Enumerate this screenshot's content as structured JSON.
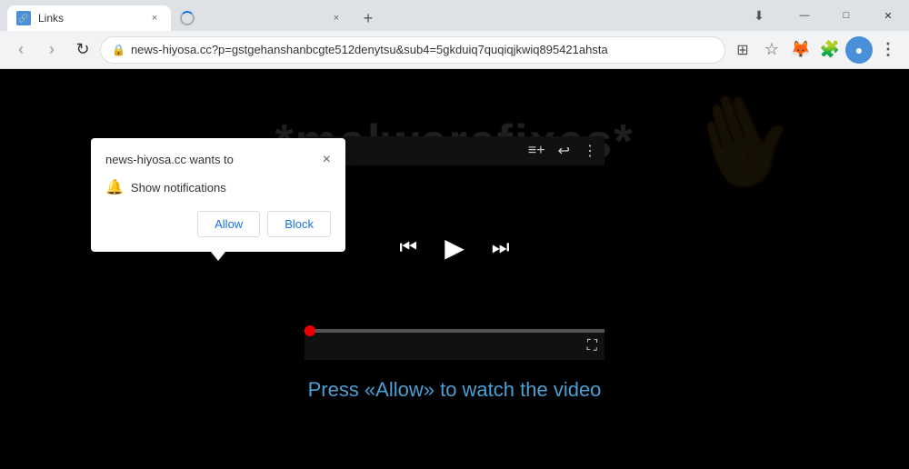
{
  "titlebar": {
    "tab1": {
      "favicon": "🔗",
      "title": "Links",
      "close_label": "×"
    },
    "tab2": {
      "close_label": "×"
    },
    "new_tab_label": "+",
    "window_controls": {
      "minimize": "—",
      "maximize": "□",
      "close": "✕"
    }
  },
  "toolbar": {
    "back_label": "‹",
    "forward_label": "›",
    "refresh_label": "↻",
    "url": "news-hiyosa.cc?p=gstgehanshanbcgte512denytsu&sub4=5gkduiq7quqiqjkwiq895421ahsta",
    "lock_icon": "🔒",
    "extensions_icon": "⬡",
    "star_icon": "☆",
    "fox_icon": "🦊",
    "puzzle_icon": "⬡",
    "profile_icon": "●",
    "menu_icon": "⋮"
  },
  "popup": {
    "title": "news-hiyosa.cc wants to",
    "close_label": "×",
    "notification_label": "Show notifications",
    "allow_label": "Allow",
    "block_label": "Block"
  },
  "video_player": {
    "top_icons": [
      "≡+",
      "↩",
      "⋮"
    ],
    "prev_label": "⏮",
    "play_label": "▶",
    "next_label": "⏭",
    "fullscreen_label": "⛶"
  },
  "page": {
    "watermark": "*malwarefixes*",
    "press_text": "Press «Allow» to watch the video"
  }
}
